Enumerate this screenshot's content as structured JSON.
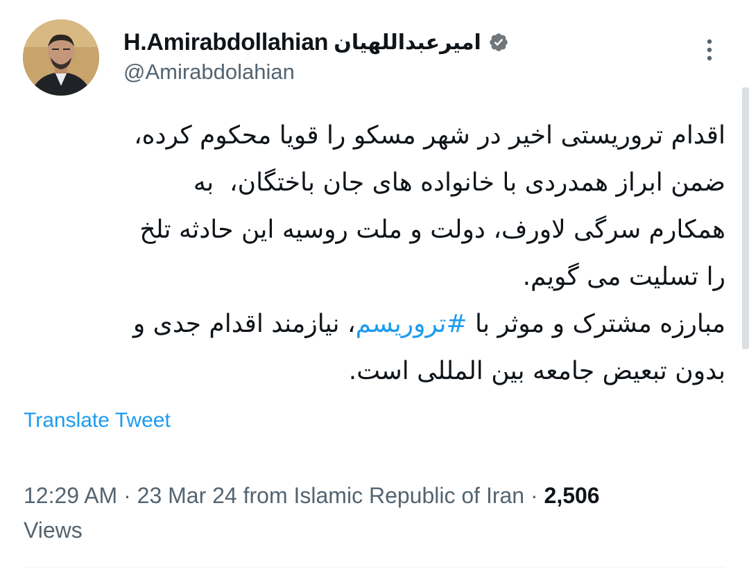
{
  "author": {
    "display_name": "H.Amirabdollahian",
    "display_name_fa": "امیرعبداللهیان",
    "handle": "@Amirabdolahian",
    "verified_icon": "verified-badge-icon",
    "verified_color": "#71767b"
  },
  "menu": {
    "icon": "more-vertical-icon"
  },
  "tweet": {
    "text_line1": "اقدام تروریستی اخیر در شهر مسکو را قویا محکوم کرده،",
    "text_line2": "ضمن ابراز همدردی با خانواده های جان باختگان،  به",
    "text_line3": "همکارم سرگی لاورف، دولت و ملت روسیه این حادثه تلخ",
    "text_line4": "را تسلیت می گویم.",
    "text_line5_before": "مبارزه مشترک و موثر با ",
    "hashtag": "#تروریسم",
    "text_line5_after": "، نیازمند اقدام جدی و",
    "text_line6": "بدون تبعیض جامعه بین المللی است.",
    "translate_label": "Translate Tweet"
  },
  "meta": {
    "time": "12:29 AM",
    "date": "23 Mar 24",
    "source": "from Islamic Republic of Iran",
    "views_count": "2,506",
    "views_label": "Views"
  },
  "colors": {
    "link": "#1d9bf0",
    "secondary": "#536471",
    "text": "#0f1419"
  }
}
